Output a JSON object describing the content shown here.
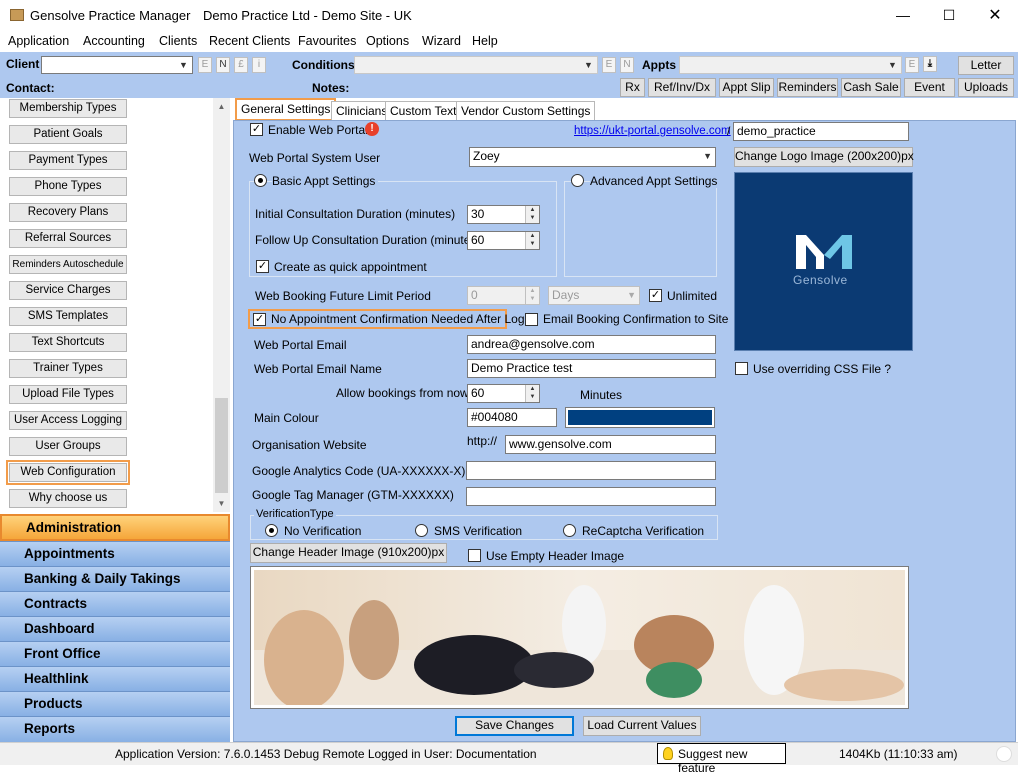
{
  "window": {
    "app_title": "Gensolve Practice Manager",
    "doc_title": "Demo Practice Ltd - Demo Site - UK"
  },
  "menu": [
    "Application",
    "Accounting",
    "Clients",
    "Recent Clients",
    "Favourites",
    "Options",
    "Wizard",
    "Help"
  ],
  "toolbar": {
    "client_label": "Client",
    "conditions_label": "Conditions",
    "appts_label": "Appts",
    "contact_label": "Contact:",
    "notes_label": "Notes:",
    "tiny_e": "E",
    "tiny_n": "N",
    "tiny_pound": "£",
    "tiny_i": "i",
    "letter": "Letter",
    "rx": "Rx",
    "ref": "Ref/Inv/Dx",
    "appt_slip": "Appt Slip",
    "reminders": "Reminders",
    "cash_sale": "Cash Sale",
    "event": "Event",
    "uploads": "Uploads"
  },
  "sidebar": {
    "items": [
      "Membership Types",
      "Patient Goals",
      "Payment Types",
      "Phone Types",
      "Recovery Plans",
      "Referral Sources",
      "Reminders Autoschedule",
      "Service Charges",
      "SMS Templates",
      "Text Shortcuts",
      "Trainer Types",
      "Upload File Types",
      "User Access Logging",
      "User Groups",
      "Web Configuration",
      "Why choose us"
    ],
    "nav": [
      "Administration",
      "Appointments",
      "Banking & Daily Takings",
      "Contracts",
      "Dashboard",
      "Front Office",
      "Healthlink",
      "Products",
      "Reports"
    ]
  },
  "tabs": [
    "General Settings",
    "Clinicians",
    "Custom Text",
    "Vendor Custom Settings"
  ],
  "form": {
    "enable_web_portal": "Enable Web Portal",
    "portal_url": "https://ukt-portal.gensolve.com",
    "slash": "/",
    "portal_path": "demo_practice",
    "system_user_label": "Web Portal System User",
    "system_user_value": "Zoey",
    "change_logo": "Change Logo Image (200x200)px",
    "basic_appt": "Basic Appt Settings",
    "advanced_appt": "Advanced Appt Settings",
    "initial_label": "Initial Consultation Duration (minutes)",
    "initial_value": "30",
    "followup_label": "Follow Up Consultation Duration (minutes)",
    "followup_value": "60",
    "quick_appt": "Create as quick appointment",
    "future_limit_label": "Web Booking Future Limit Period",
    "future_limit_value": "0",
    "days": "Days",
    "unlimited": "Unlimited",
    "no_confirm": "No Appointment Confirmation Needed After Login",
    "email_confirm": "Email Booking Confirmation to Site",
    "portal_email_label": "Web Portal Email",
    "portal_email_value": "andrea@gensolve.com",
    "portal_email_name_label": "Web Portal Email Name",
    "portal_email_name_value": "Demo Practice test",
    "allow_bookings_label": "Allow bookings from now +",
    "allow_bookings_value": "60",
    "minutes": "Minutes",
    "main_colour_label": "Main Colour",
    "main_colour_value": "#004080",
    "org_website_label": "Organisation Website",
    "http_prefix": "http://",
    "org_website_value": "www.gensolve.com",
    "ga_label": "Google Analytics Code (UA-XXXXXX-X)",
    "gtm_label": "Google Tag Manager (GTM-XXXXXX)",
    "verification_title": "VerificationType",
    "no_verification": "No Verification",
    "sms_verification": "SMS Verification",
    "recaptcha": "ReCaptcha Verification",
    "change_header": "Change Header Image (910x200)px",
    "use_empty_header": "Use Empty Header Image",
    "override_css": "Use overriding CSS File ?",
    "logo_text": "Gensolve",
    "save": "Save Changes",
    "load": "Load Current Values"
  },
  "status": {
    "version": "Application Version: 7.6.0.1453 Debug Remote  Logged in User: Documentation",
    "suggest": "Suggest new feature",
    "memory": "1404Kb  (11:10:33 am)"
  },
  "colors": {
    "accent_orange": "#f29c4a",
    "panel_blue": "#aec8ef",
    "main_colour": "#004080",
    "logo_bg": "#0b3a73"
  }
}
